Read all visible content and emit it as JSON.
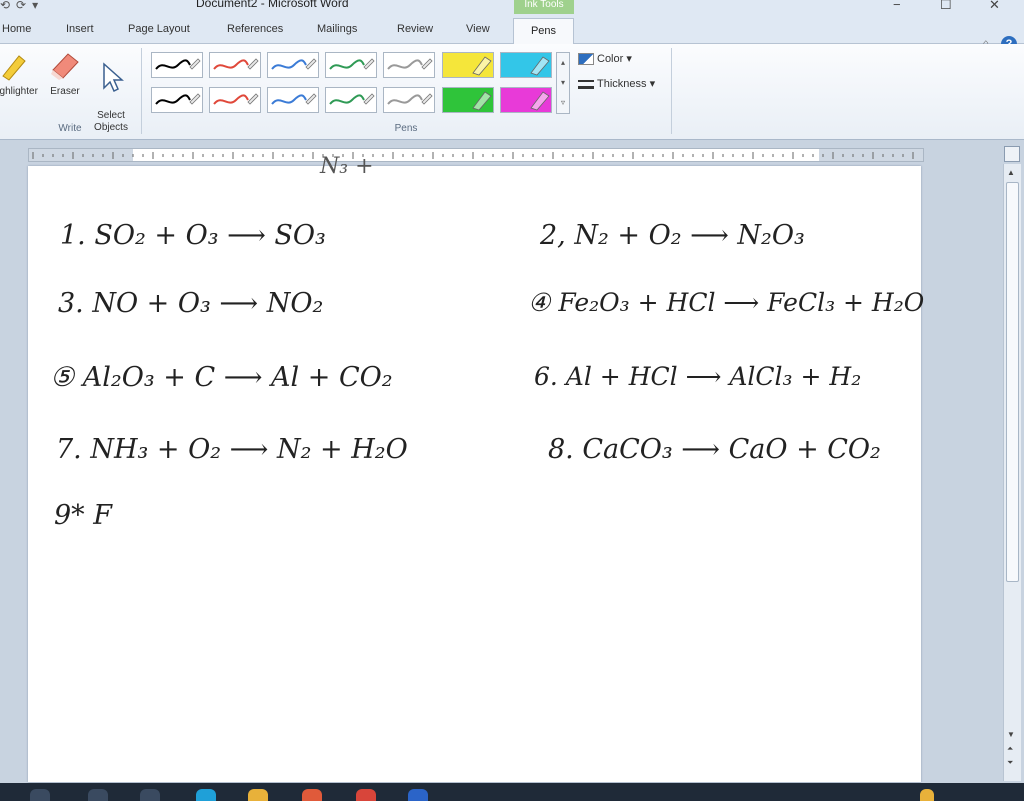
{
  "titlebar": {
    "title": "Document2 - Microsoft Word",
    "context_tab": "Ink Tools",
    "minimize": "−",
    "maximize": "☐",
    "close": "✕"
  },
  "tabs": [
    {
      "label": "Home"
    },
    {
      "label": "Insert"
    },
    {
      "label": "Page Layout"
    },
    {
      "label": "References"
    },
    {
      "label": "Mailings"
    },
    {
      "label": "Review"
    },
    {
      "label": "View"
    },
    {
      "label": "Pens",
      "active": true
    }
  ],
  "help": "?",
  "ribbon": {
    "write_group": {
      "label": "Write",
      "buttons": [
        {
          "label": "Highlighter",
          "icon": "highlighter-icon"
        },
        {
          "label": "Eraser",
          "icon": "eraser-icon"
        },
        {
          "label": "Select\nObjects",
          "icon": "select-cursor-icon"
        }
      ]
    },
    "pens_group": {
      "label": "Pens",
      "pen_colors_row1": [
        "#000000",
        "#e0483a",
        "#3b7bd6",
        "#2f9a55",
        "#999999"
      ],
      "pen_colors_row2": [
        "#000000",
        "#e0483a",
        "#3b7bd6",
        "#2f9a55",
        "#999999"
      ],
      "highlighters_row1": [
        "#f5e63a",
        "#33c6e8"
      ],
      "highlighters_row2": [
        "#2fc43a",
        "#e83ad8"
      ],
      "color_label": "Color",
      "thickness_label": "Thickness"
    }
  },
  "document": {
    "top_fragment": "N₃  +",
    "equations": [
      {
        "text": "1.  SO₂ +   O₃ ⟶ SO₃"
      },
      {
        "text": "2,   N₂ +    O₂ ⟶  N₂O₃"
      },
      {
        "text": "3.   NO +    O₃ ⟶    NO₂"
      },
      {
        "text": "④  Fe₂O₃ +   HCl ⟶ FeCl₃ + H₂O"
      },
      {
        "text": "⑤ Al₂O₃ +   C ⟶  Al +  CO₂"
      },
      {
        "text": "6.  Al +   HCl ⟶ AlCl₃ + H₂"
      },
      {
        "text": "7.  NH₃ +    O₂ ⟶  N₂ +   H₂O"
      },
      {
        "text": "8.   CaCO₃ ⟶ CaO  +  CO₂"
      },
      {
        "text": "9*    F"
      }
    ]
  }
}
